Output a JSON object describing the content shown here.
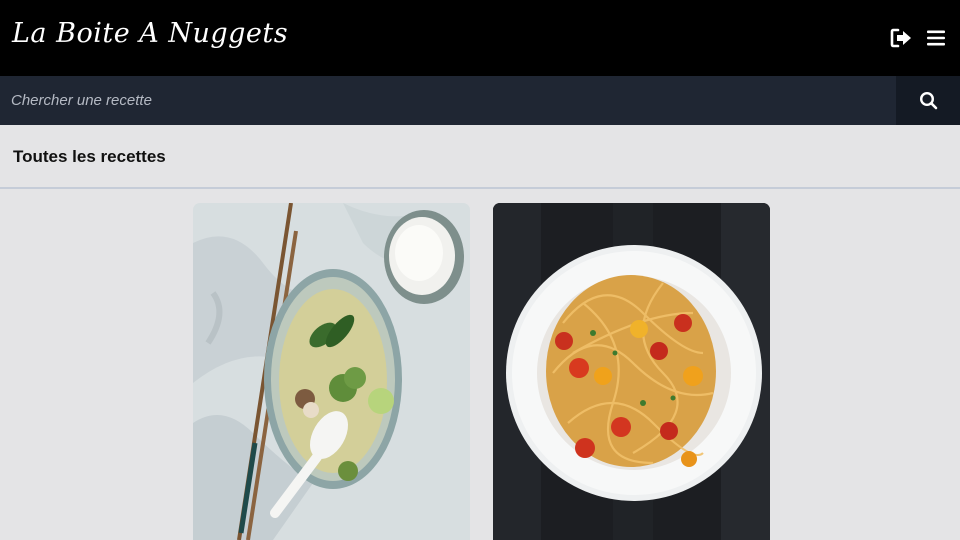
{
  "header": {
    "logo_text": "La Boite A Nuggets",
    "logout_icon": "logout-icon",
    "menu_icon": "hamburger-menu-icon"
  },
  "search": {
    "placeholder": "Chercher une recette",
    "value": "",
    "icon": "search-icon"
  },
  "main": {
    "section_title": "Toutes les recettes",
    "recipes": [
      {
        "image": "green-curry-soup-bowl-with-rice-and-chopsticks"
      },
      {
        "image": "spaghetti-with-cherry-tomatoes-on-plate"
      }
    ]
  },
  "colors": {
    "topbar": "#000000",
    "searchbar": "#1f2633",
    "search_button": "#141a24",
    "page_background": "#e4e4e6",
    "divider": "#c5ccd8"
  }
}
